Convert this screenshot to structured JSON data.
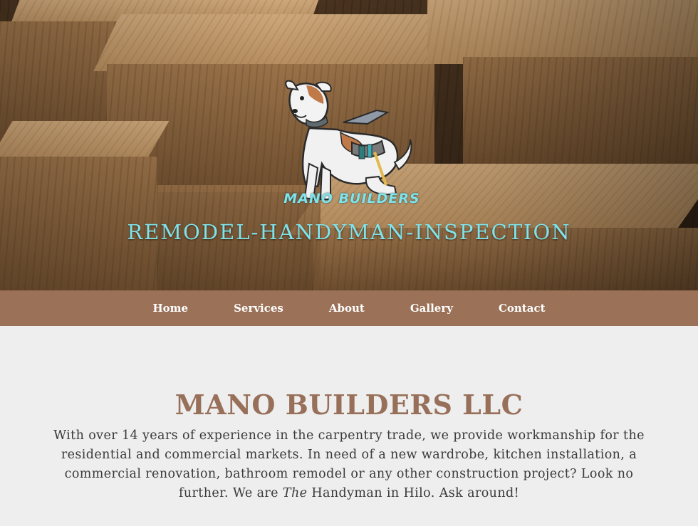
{
  "hero": {
    "logo_text": "MANO BUILDERS",
    "tagline": "REMODEL-HANDYMAN-INSPECTION"
  },
  "nav": {
    "items": [
      {
        "label": "Home"
      },
      {
        "label": "Services"
      },
      {
        "label": "About"
      },
      {
        "label": "Gallery"
      },
      {
        "label": "Contact"
      }
    ]
  },
  "main": {
    "title": "MANO BUILDERS LLC",
    "intro_before": "With over 14 years of experience in the carpentry trade, we provide workmanship for the residential and commercial markets. In need of a new wardrobe, kitchen installation, a commercial renovation, bathroom remodel or any other construction project? Look no further. We are ",
    "intro_emphasis": "The",
    "intro_after": " Handyman in Hilo. Ask around!"
  },
  "colors": {
    "accent_teal": "#7fe3ea",
    "nav_brown": "#9b7157",
    "title_brown": "#98705a",
    "page_bg": "#eeeeee"
  },
  "icons": {
    "logo": "dog-with-toolbelt-logo"
  }
}
